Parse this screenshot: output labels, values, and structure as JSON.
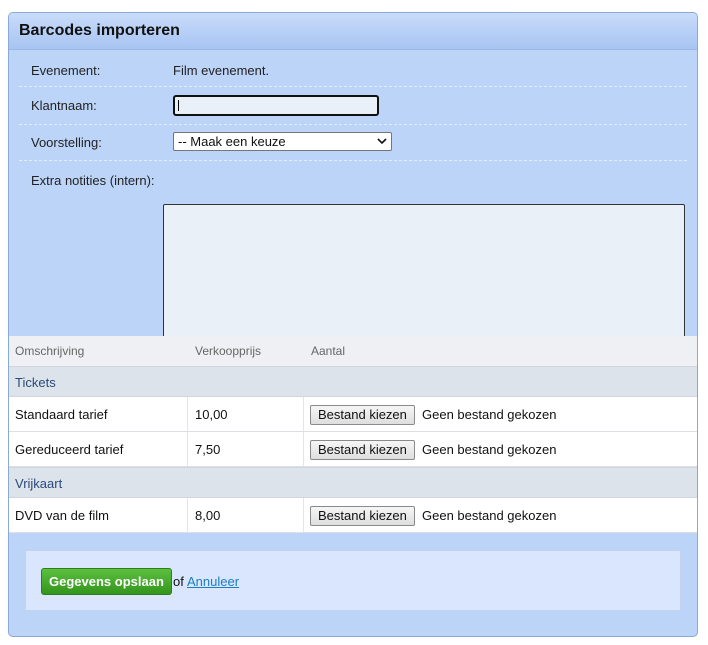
{
  "panel": {
    "title": "Barcodes importeren"
  },
  "form": {
    "event_label": "Evenement:",
    "event_value": "Film evenement.",
    "customer_label": "Klantnaam:",
    "customer_value": "",
    "show_label": "Voorstelling:",
    "show_selected": "-- Maak een keuze",
    "notes_label": "Extra notities (intern):",
    "notes_value": ""
  },
  "table": {
    "headers": [
      "Omschrijving",
      "Verkoopprijs",
      "Aantal"
    ],
    "groups": [
      {
        "name": "Tickets",
        "rows": [
          {
            "description": "Standaard tarief",
            "price": "10,00",
            "button": "Bestand kiezen",
            "file_status": "Geen bestand gekozen"
          },
          {
            "description": "Gereduceerd tarief",
            "price": "7,50",
            "button": "Bestand kiezen",
            "file_status": "Geen bestand gekozen"
          }
        ]
      },
      {
        "name": "Vrijkaart",
        "rows": [
          {
            "description": "DVD van de film",
            "price": "8,00",
            "button": "Bestand kiezen",
            "file_status": "Geen bestand gekozen"
          }
        ]
      }
    ]
  },
  "footer": {
    "save_label": "Gegevens opslaan",
    "or_text": "of",
    "cancel_label": "Annuleer"
  },
  "colors": {
    "panel_bg": "#bcd4f8",
    "save_button": "#3fa826",
    "link": "#1a7fc1"
  }
}
